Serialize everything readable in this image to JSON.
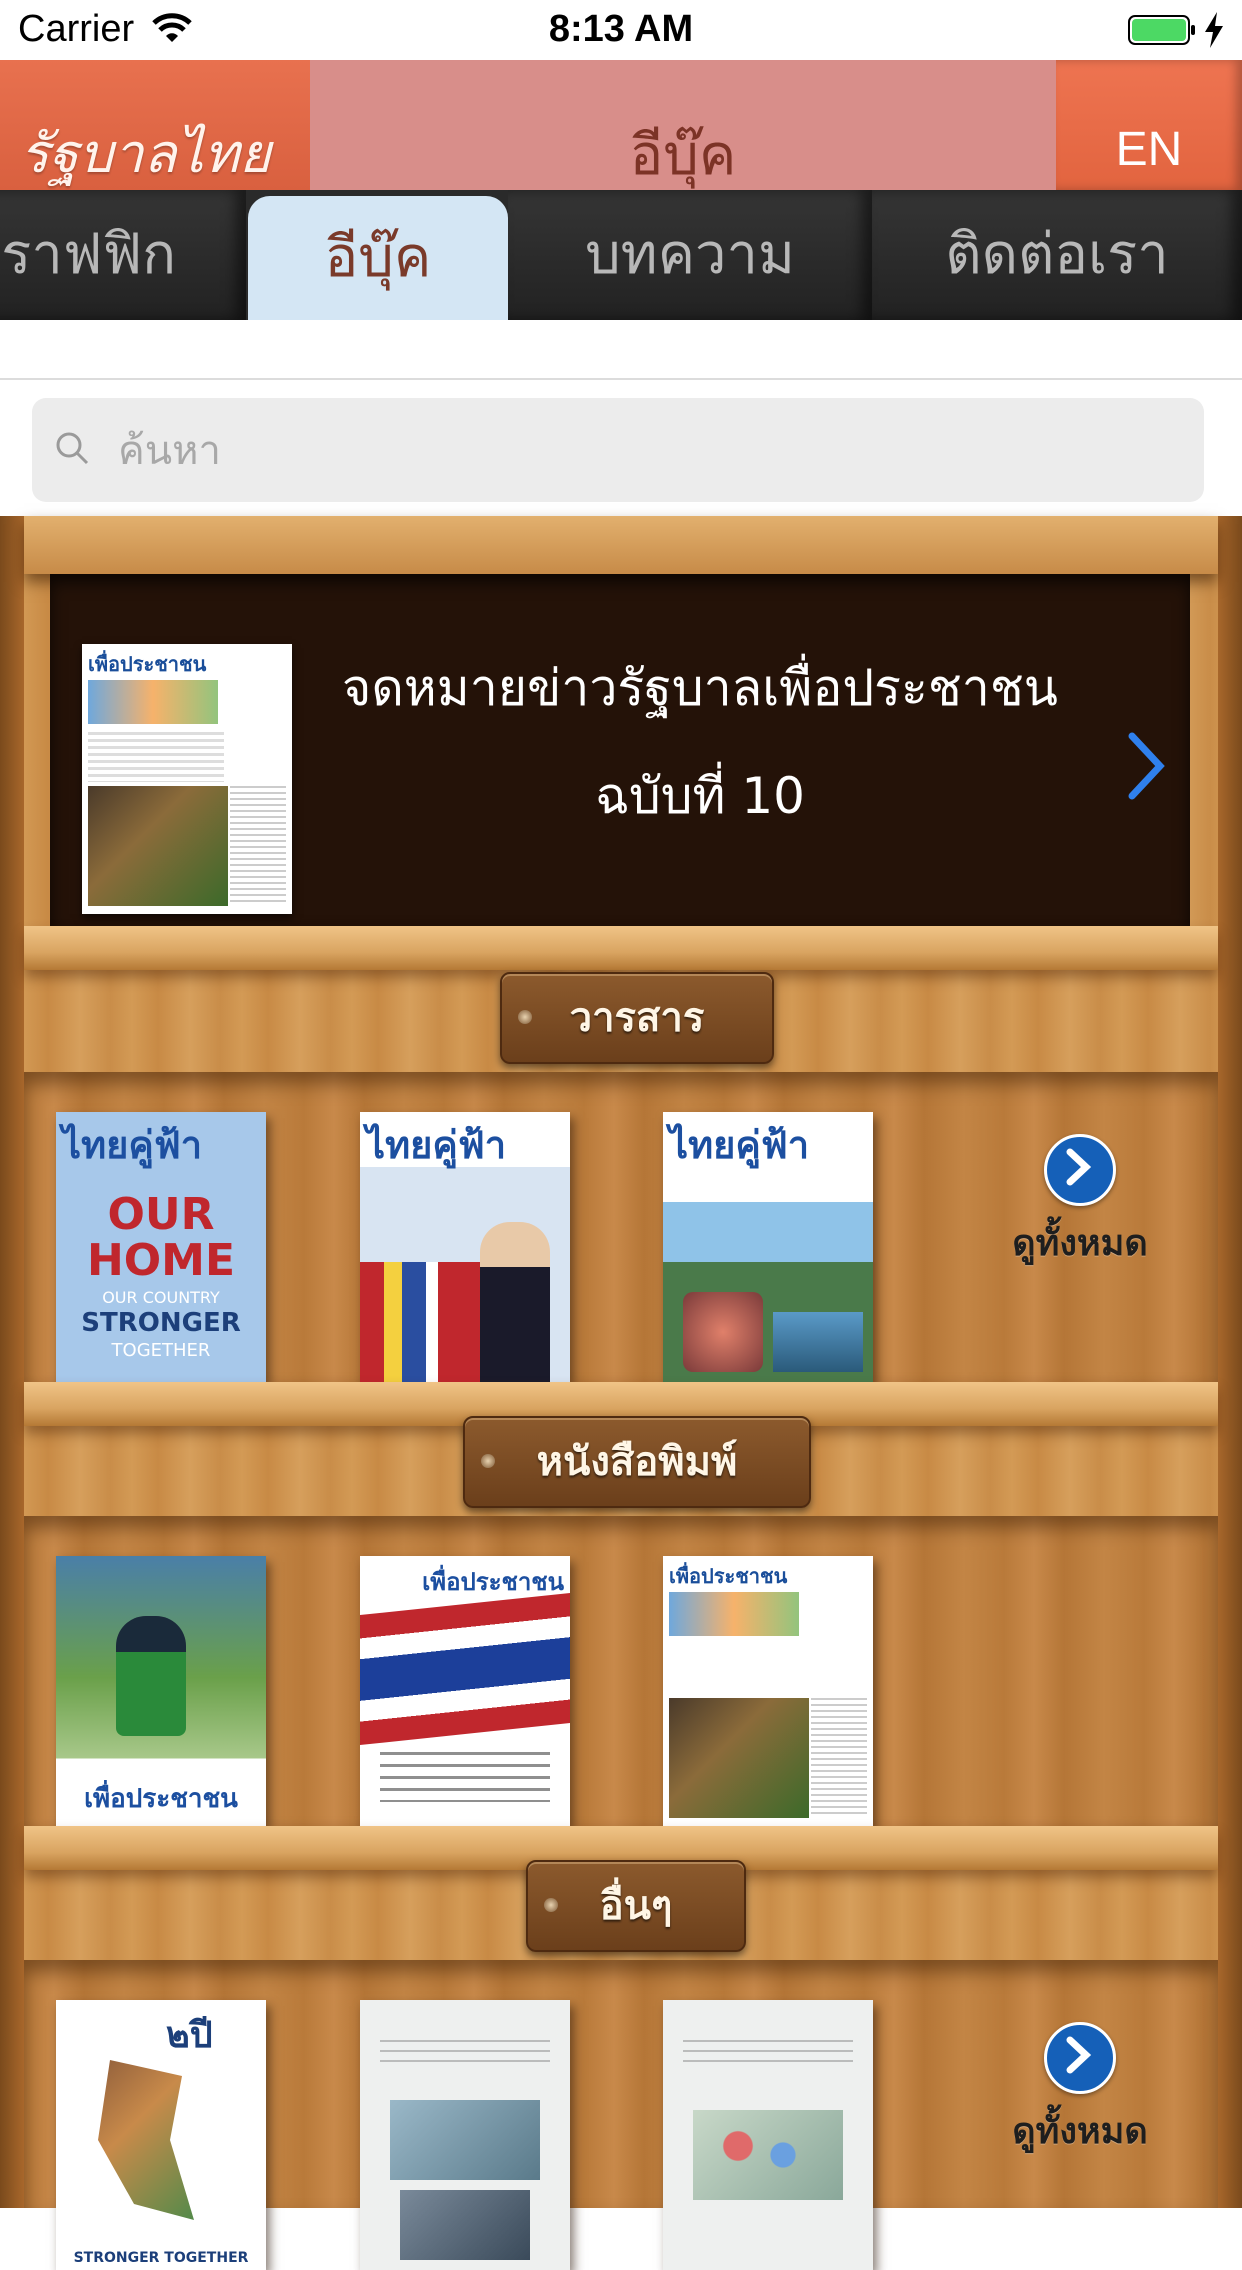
{
  "status_bar": {
    "carrier": "Carrier",
    "time": "8:13 AM"
  },
  "header": {
    "logo_text": "รัฐบาลไทย",
    "title": "อีบุ๊ค",
    "language_button": "EN"
  },
  "tabs": [
    {
      "label": "อินโฟกราฟฟิก",
      "active": false
    },
    {
      "label": "อีบุ๊ค",
      "active": true
    },
    {
      "label": "บทความ",
      "active": false
    },
    {
      "label": "ติดต่อเรา",
      "active": false
    }
  ],
  "tab_visible_labels": [
    "ราฟฟิก",
    "อีบุ๊ค",
    "บทความ",
    "ติดต่อเรา"
  ],
  "search": {
    "placeholder": "ค้นหา"
  },
  "featured": {
    "title_line1": "จดหมายข่าวรัฐบาลเพื่อประชาชน",
    "title_line2": "ฉบับที่ 10"
  },
  "sections": [
    {
      "label": "วารสาร",
      "view_all": "ดูทั้งหมด"
    },
    {
      "label": "หนังสือพิมพ์"
    },
    {
      "label": "อื่นๆ",
      "view_all": "ดูทั้งหมด"
    }
  ],
  "book_texts": {
    "thai_kufa": "ไทยคู่ฟ้า",
    "puea_prachachon": "เพื่อประชาชน",
    "our_home": "OUR HOME",
    "our_country": "OUR COUNTRY",
    "stronger": "STRONGER",
    "together": "TOGETHER",
    "two_years": "๒ปี",
    "stronger_together": "STRONGER TOGETHER"
  },
  "colors": {
    "header_orange": "#e8704f",
    "header_title_bg": "#d88e8a",
    "tab_active_bg": "#d4e6f4",
    "view_all_blue": "#1560b8",
    "chevron_blue": "#2f80ed"
  }
}
